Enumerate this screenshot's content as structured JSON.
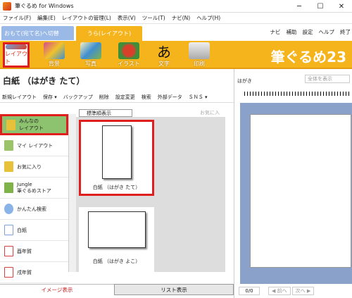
{
  "window": {
    "title": "筆ぐるめ for Windows",
    "min_icon": "─",
    "max_icon": "☐",
    "close_icon": "✕"
  },
  "menu": [
    "ファイル(F)",
    "編集(E)",
    "レイアウトの管理(L)",
    "表示(V)",
    "ツール(T)",
    "ナビ(N)",
    "ヘルプ(H)"
  ],
  "tabs": {
    "front": "おもて(宛て名)へ切替",
    "back": "うら(レイアウト)"
  },
  "help": {
    "navi": "ナビ",
    "assist": "補助",
    "settings": "設定",
    "help": "ヘルプ",
    "exit": "終了"
  },
  "tools": [
    {
      "label": "レイアウト",
      "color": "#6fa0d8"
    },
    {
      "label": "背景",
      "color": "#d44a92"
    },
    {
      "label": "写真",
      "color": "#3f8fd0"
    },
    {
      "label": "イラスト",
      "color": "#d8402b"
    },
    {
      "label": "文字",
      "color": "#f6b41c"
    },
    {
      "label": "印刷",
      "color": "#cfcfcf"
    }
  ],
  "logo": "筆ぐるめ23",
  "doc_title": "白紙 （はがき たて）",
  "actions": [
    "新規レイアウト",
    "保存 ▾",
    "バックアップ",
    "削除",
    "設定変更",
    "検索",
    "外部データ",
    "ＳＮＳ ▾"
  ],
  "sort_label": "標準順表示",
  "fav_tag": "お気に入",
  "sidebar": [
    {
      "label": "みんなの\nレイアウト",
      "icon_color": "#e8c13a"
    },
    {
      "label": "マイ レイアウト",
      "icon_color": "#9bc36a"
    },
    {
      "label": "お気に入り",
      "icon_color": "#e8c13a"
    },
    {
      "label": "Jungle\n筆ぐるめストア",
      "icon_color": "#7fb34a"
    },
    {
      "label": "かんたん検索",
      "icon_color": "#8ab4e8"
    },
    {
      "label": "白紙",
      "icon_color": "#7ea2d6"
    },
    {
      "label": "酉年賀",
      "icon_color": "#d84040"
    },
    {
      "label": "戌年賀",
      "icon_color": "#d84040"
    }
  ],
  "cards": [
    {
      "label": "白紙 （はがき たて）"
    },
    {
      "label": "白紙 （はがき よこ）"
    }
  ],
  "bottom_tabs": {
    "image": "イメージ表示",
    "list": "リスト表示"
  },
  "preview": {
    "label": "はがき",
    "select": "全体を表示",
    "page_count": "0/0",
    "prev": "◀ 前へ",
    "next": "次へ ▶"
  }
}
